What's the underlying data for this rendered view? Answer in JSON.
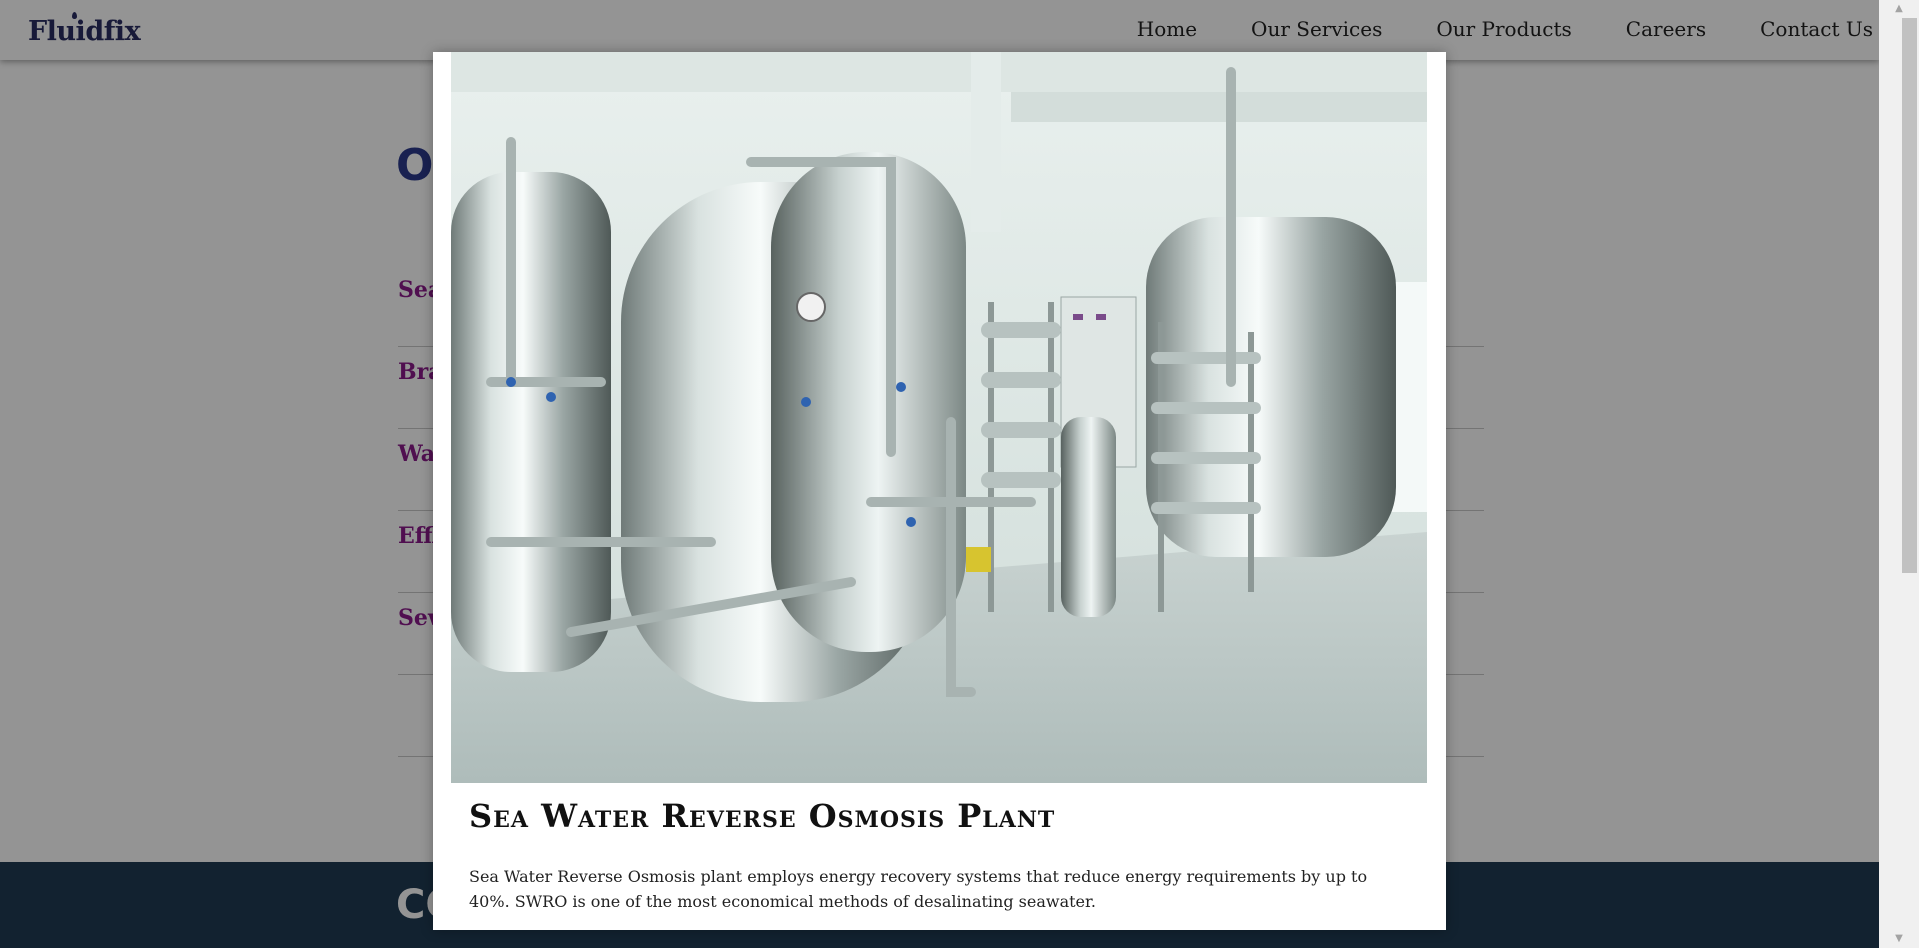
{
  "header": {
    "logo": "Fluidfix",
    "nav": [
      "Home",
      "Our Services",
      "Our Products",
      "Careers",
      "Contact Us"
    ]
  },
  "background": {
    "section_title_partial": "O",
    "services_partial": [
      "Sea",
      "Bra",
      "Wat",
      "Effl",
      "Sew"
    ],
    "footer_logo_partial": "CC"
  },
  "modal": {
    "title": "Sea Water Reverse Osmosis Plant",
    "description": "Sea Water Reverse Osmosis plant employs energy recovery systems that reduce energy requirements by up to 40%. SWRO is one of the most economical methods of desalinating seawater."
  },
  "colors": {
    "brand": "#2a2e63",
    "service_link": "#8a1a8a",
    "footer_bg": "#1f3b53",
    "overlay": "rgba(0,0,0,0.42)"
  }
}
